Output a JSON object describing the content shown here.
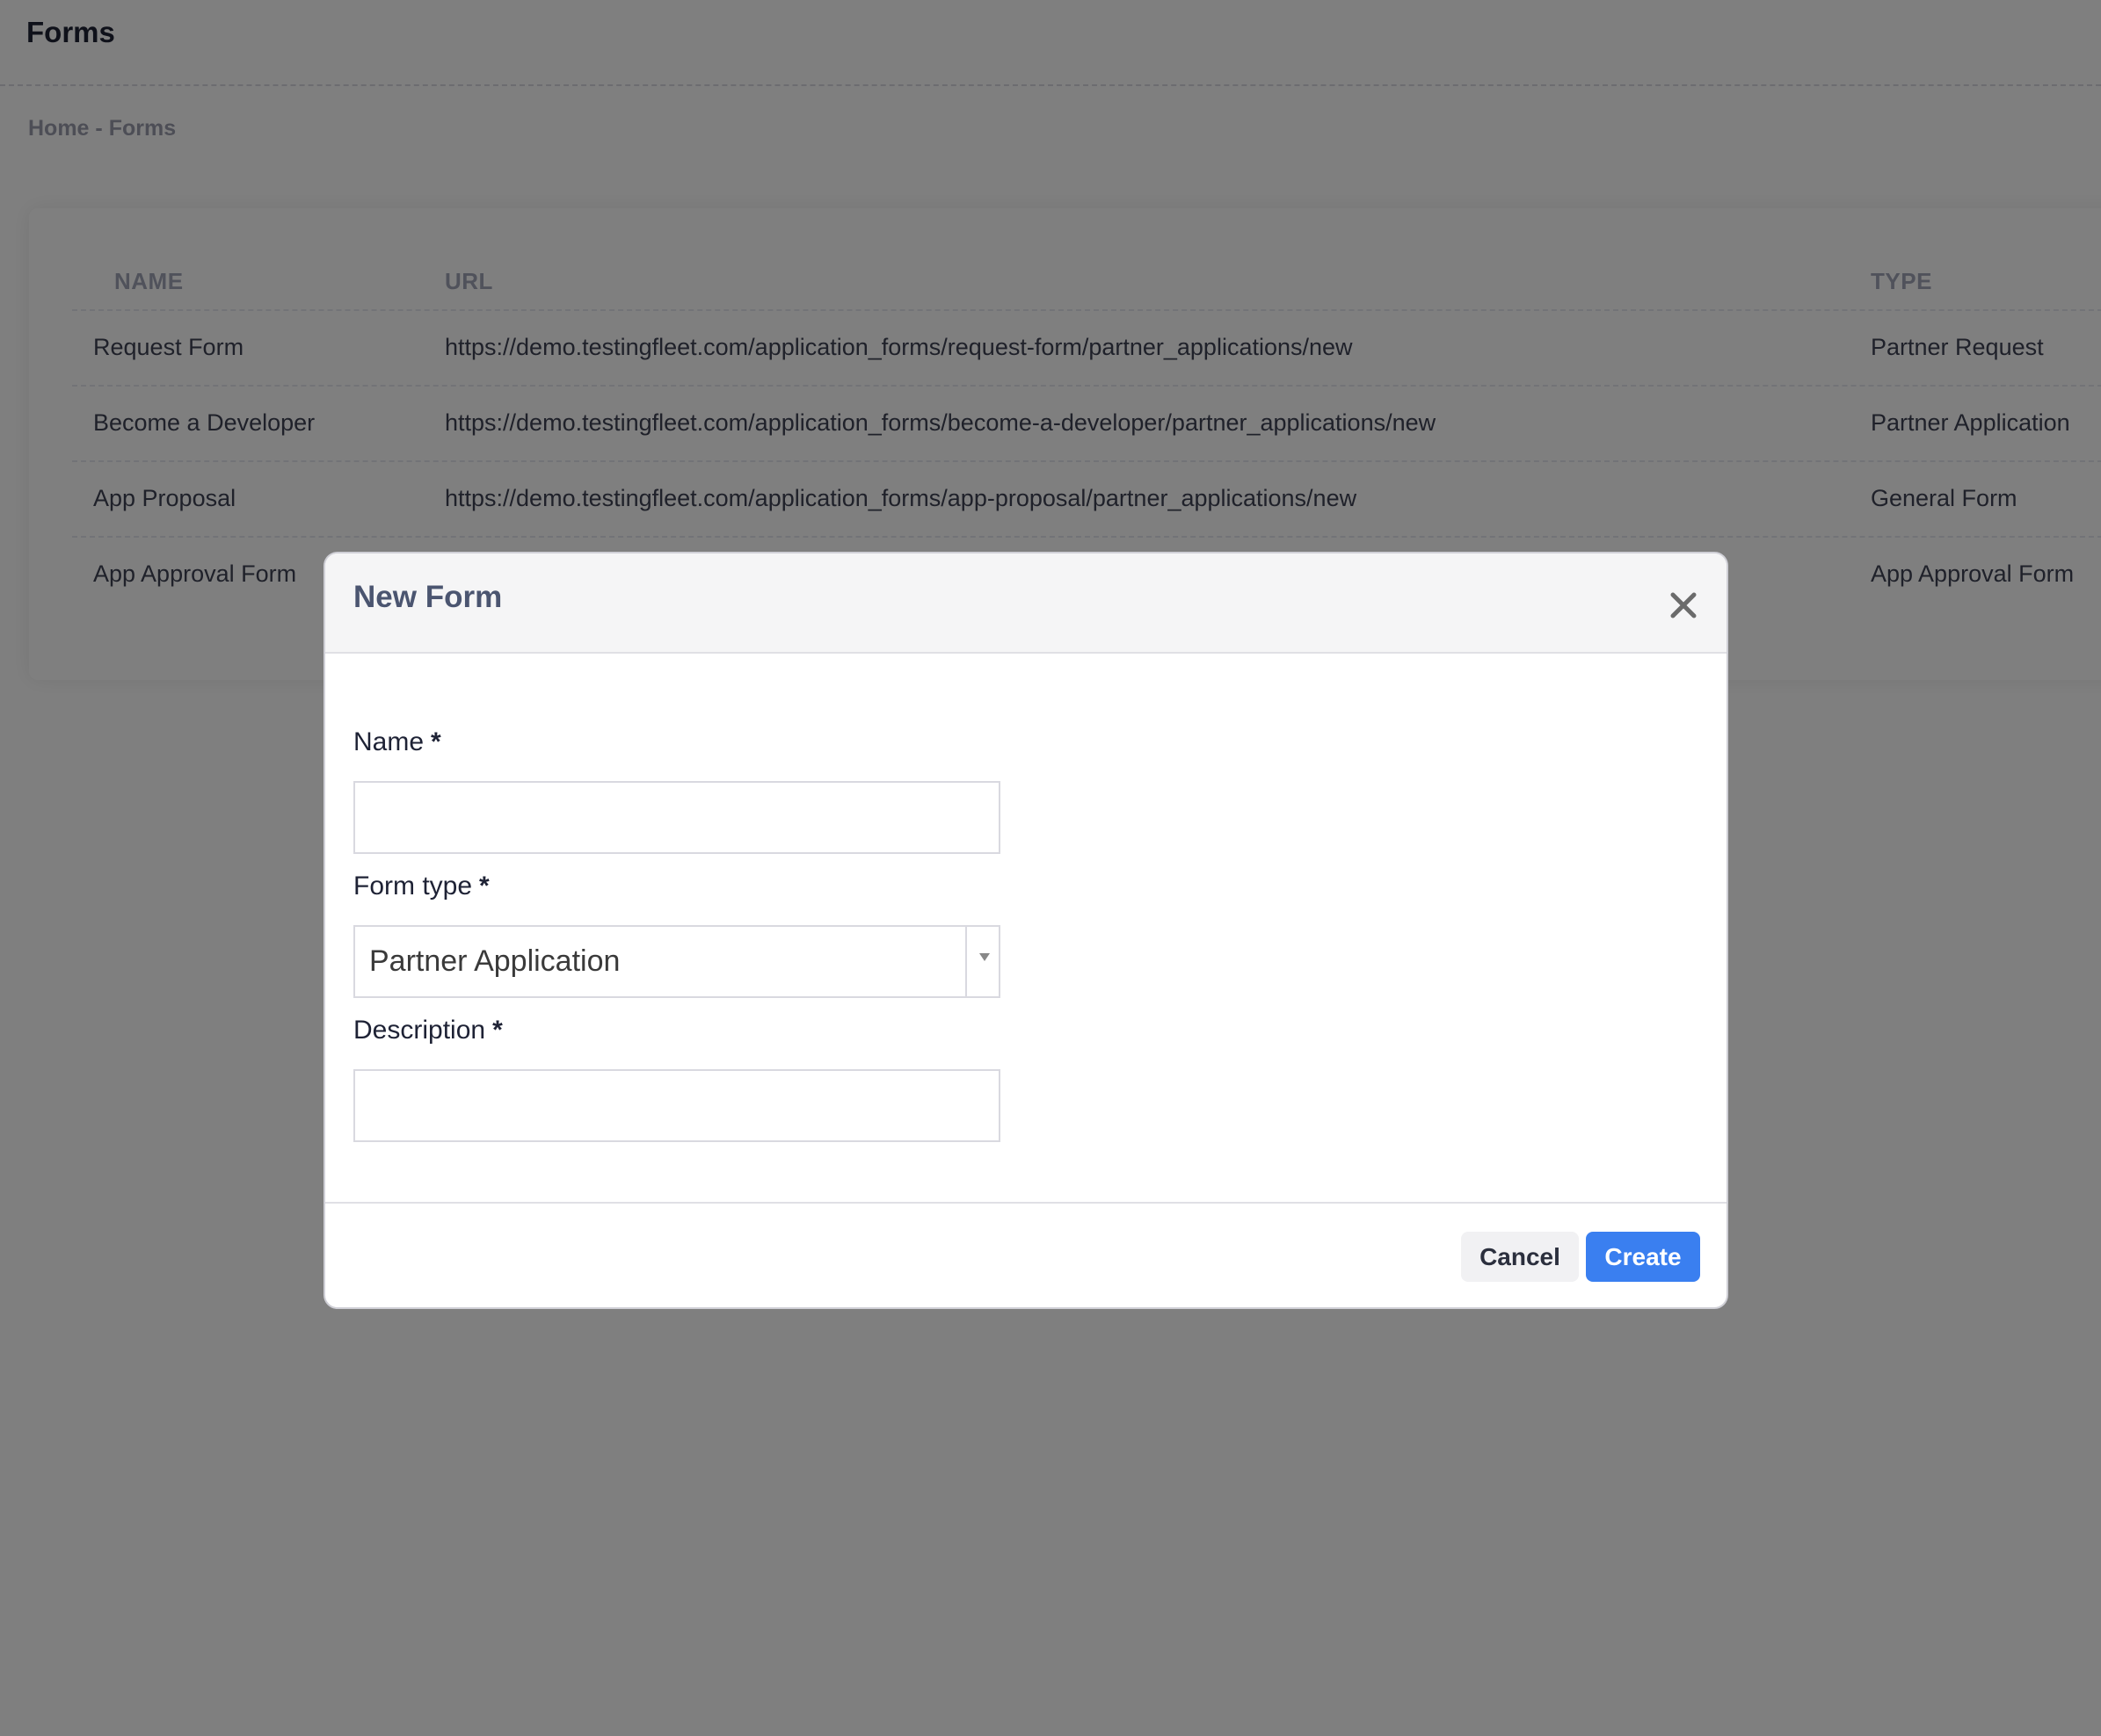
{
  "page": {
    "title": "Forms",
    "breadcrumb": {
      "home": "Home",
      "separator": "-",
      "current": "Forms"
    }
  },
  "table": {
    "headers": {
      "name": "NAME",
      "url": "URL",
      "type": "TYPE"
    },
    "rows": [
      {
        "name": "Request Form",
        "url": "https://demo.testingfleet.com/application_forms/request-form/partner_applications/new",
        "type": "Partner Request"
      },
      {
        "name": "Become a Developer",
        "url": "https://demo.testingfleet.com/application_forms/become-a-developer/partner_applications/new",
        "type": "Partner Application"
      },
      {
        "name": "App Proposal",
        "url": "https://demo.testingfleet.com/application_forms/app-proposal/partner_applications/new",
        "type": "General Form"
      },
      {
        "name": "App Approval Form",
        "url": "",
        "type": "App Approval Form"
      }
    ]
  },
  "modal": {
    "title": "New Form",
    "close_icon": "close-icon",
    "fields": {
      "name": {
        "label": "Name",
        "required_mark": "*",
        "value": "",
        "placeholder": ""
      },
      "form_type": {
        "label": "Form type",
        "required_mark": "*",
        "selected": "Partner Application"
      },
      "description": {
        "label": "Description",
        "required_mark": "*",
        "value": "",
        "placeholder": ""
      }
    },
    "buttons": {
      "cancel": "Cancel",
      "create": "Create"
    }
  },
  "colors": {
    "primary": "#3a7ff0",
    "backdrop": "rgba(0,0,0,0.5)",
    "cancel_bg": "#f1f1f3"
  }
}
